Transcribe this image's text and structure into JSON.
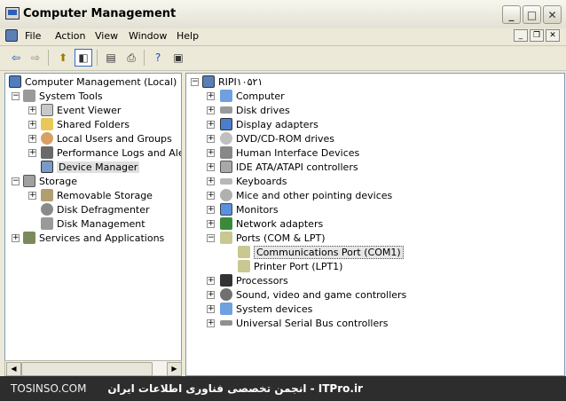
{
  "window": {
    "title": "Computer Management"
  },
  "title_buttons": {
    "minimize": "_",
    "maximize": "□",
    "close": "✕"
  },
  "menu": [
    "File",
    "Action",
    "View",
    "Window",
    "Help"
  ],
  "left_tree": [
    {
      "label": "Computer Management (Local)",
      "icon": "computer-management-icon"
    },
    {
      "label": "System Tools",
      "icon": "tools-icon",
      "expander": "−"
    },
    {
      "label": "Event Viewer",
      "icon": "event-viewer-icon",
      "expander": "+"
    },
    {
      "label": "Shared Folders",
      "icon": "shared-folders-icon",
      "expander": "+"
    },
    {
      "label": "Local Users and Groups",
      "icon": "users-icon",
      "expander": "+"
    },
    {
      "label": "Performance Logs and Alerts",
      "icon": "performance-icon",
      "expander": "+"
    },
    {
      "label": "Device Manager",
      "icon": "device-manager-icon",
      "selected": true
    },
    {
      "label": "Storage",
      "icon": "storage-icon",
      "expander": "−"
    },
    {
      "label": "Removable Storage",
      "icon": "removable-storage-icon",
      "expander": "+"
    },
    {
      "label": "Disk Defragmenter",
      "icon": "defragmenter-icon"
    },
    {
      "label": "Disk Management",
      "icon": "disk-management-icon"
    },
    {
      "label": "Services and Applications",
      "icon": "services-icon",
      "expander": "+"
    }
  ],
  "right_tree": [
    {
      "label": "RIPI۱۰۵۲۱",
      "icon": "computer-icon",
      "expander": "−"
    },
    {
      "label": "Computer",
      "icon": "computer-icon",
      "expander": "+"
    },
    {
      "label": "Disk drives",
      "icon": "disk-drive-icon",
      "expander": "+"
    },
    {
      "label": "Display adapters",
      "icon": "display-adapter-icon",
      "expander": "+"
    },
    {
      "label": "DVD/CD-ROM drives",
      "icon": "cdrom-icon",
      "expander": "+"
    },
    {
      "label": "Human Interface Devices",
      "icon": "hid-icon",
      "expander": "+"
    },
    {
      "label": "IDE ATA/ATAPI controllers",
      "icon": "ide-icon",
      "expander": "+"
    },
    {
      "label": "Keyboards",
      "icon": "keyboard-icon",
      "expander": "+"
    },
    {
      "label": "Mice and other pointing devices",
      "icon": "mouse-icon",
      "expander": "+"
    },
    {
      "label": "Monitors",
      "icon": "monitor-icon",
      "expander": "+"
    },
    {
      "label": "Network adapters",
      "icon": "network-icon",
      "expander": "+"
    },
    {
      "label": "Ports (COM & LPT)",
      "icon": "port-icon",
      "expander": "−"
    },
    {
      "label": "Communications Port (COM1)",
      "icon": "port-icon",
      "selected": true
    },
    {
      "label": "Printer Port (LPT1)",
      "icon": "port-icon"
    },
    {
      "label": "Processors",
      "icon": "processor-icon",
      "expander": "+"
    },
    {
      "label": "Sound, video and game controllers",
      "icon": "sound-icon",
      "expander": "+"
    },
    {
      "label": "System devices",
      "icon": "system-device-icon",
      "expander": "+"
    },
    {
      "label": "Universal Serial Bus controllers",
      "icon": "usb-icon",
      "expander": "+"
    }
  ],
  "status": {
    "left": "TOSINSO.COM",
    "right": "انجمن تخصصی فناوری اطلاعات ایران - ITPro.ir"
  },
  "colors": {
    "selection_border": "#316AC5",
    "pane_border": "#7F9DB9",
    "status_bg": "#2D2D2D"
  }
}
